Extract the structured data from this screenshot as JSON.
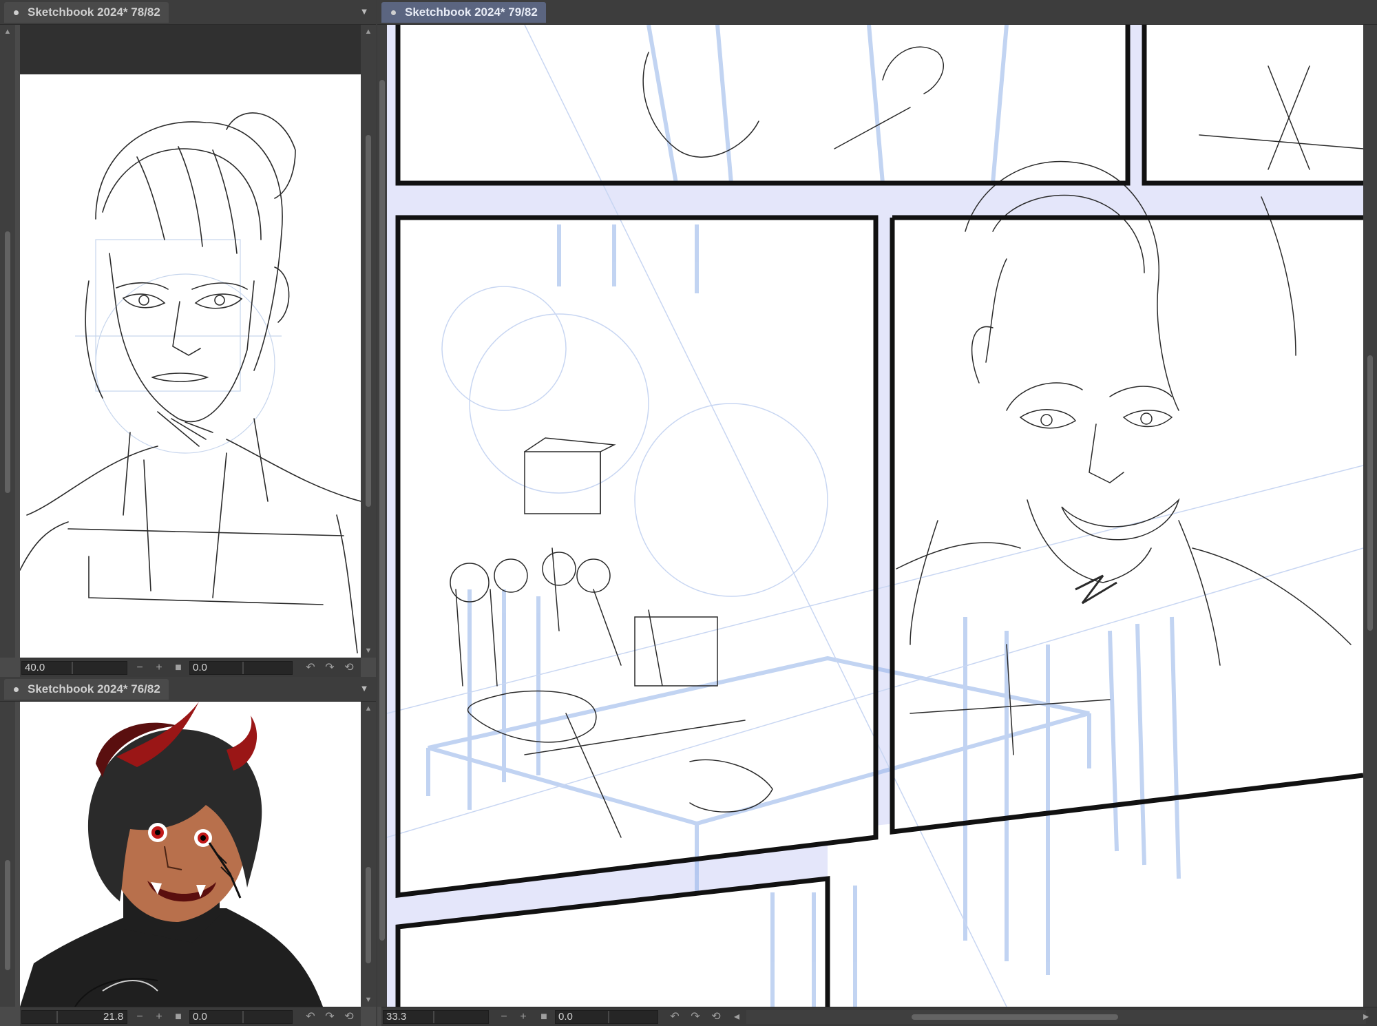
{
  "panels": {
    "top_left": {
      "tab_title": "Sketchbook 2024* 78/82",
      "zoom": "40.0",
      "rotation": "0.0"
    },
    "bottom_left": {
      "tab_title": "Sketchbook 2024* 76/82",
      "zoom": "21.8",
      "rotation": "0.0"
    },
    "main": {
      "tab_title": "Sketchbook 2024* 79/82",
      "zoom": "33.3",
      "rotation": "0.0"
    }
  },
  "icons": {
    "tab_dot": "bullet-icon",
    "tab_menu": "chevron-down-icon",
    "zoom_out": "minus-icon",
    "zoom_in": "plus-icon",
    "fit": "square-icon",
    "rotate_left": "rotate-left-icon",
    "rotate_right": "rotate-right-icon",
    "reset": "reset-rotation-icon"
  },
  "colors": {
    "app_background": "#3c3c3c",
    "active_tab": "#5b6580",
    "comic_gutter": "#e4e6fa",
    "blue_line": "#8fb0e8",
    "panel_border": "#111111"
  }
}
